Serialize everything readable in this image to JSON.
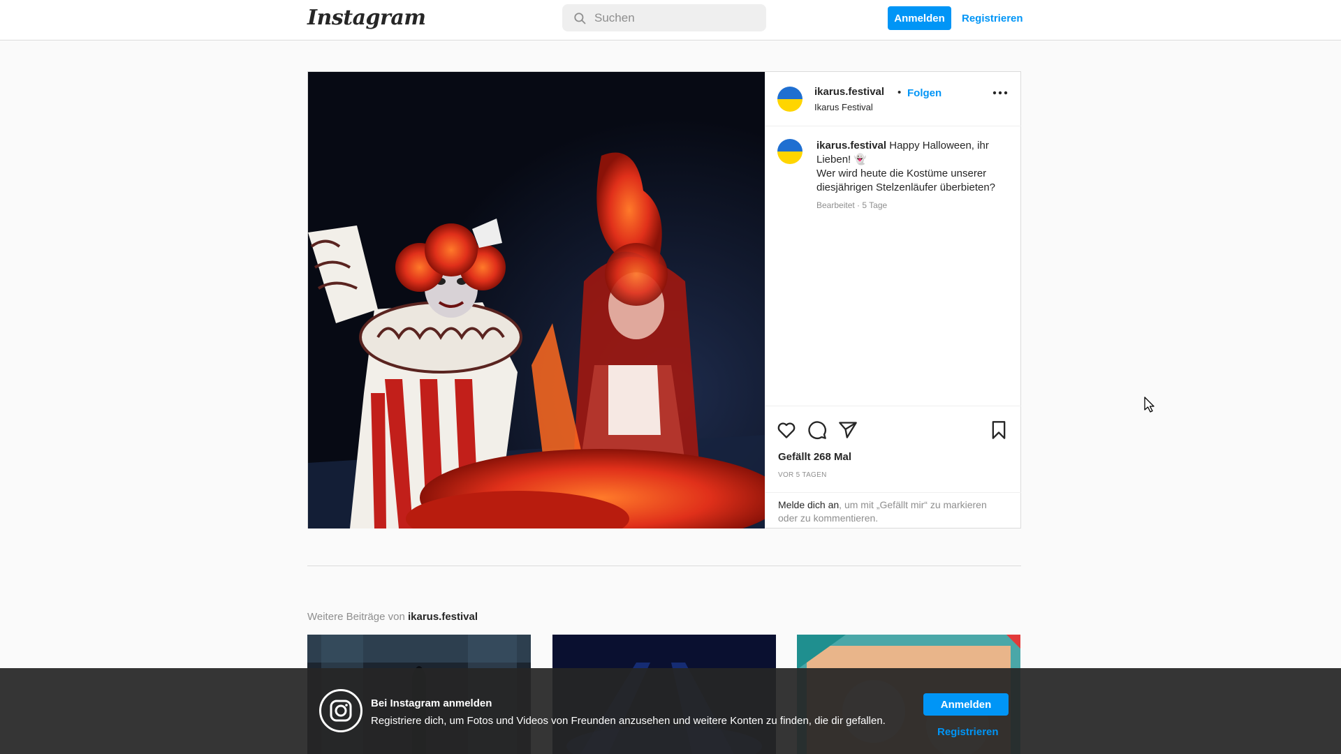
{
  "header": {
    "logo": "Instagram",
    "search_placeholder": "Suchen",
    "login_label": "Anmelden",
    "register_label": "Registrieren"
  },
  "post": {
    "username": "ikarus.festival",
    "separator": "•",
    "follow_label": "Folgen",
    "display_name": "Ikarus Festival",
    "caption_user": "ikarus.festival",
    "caption_text": "Happy Halloween, ihr Lieben! 👻",
    "caption_text_2": "Wer wird heute die Kostüme unserer diesjährigen Stelzenläufer überbieten?",
    "edited_meta": "Bearbeitet · 5 Tage",
    "likes": "Gefällt 268 Mal",
    "time": "VOR 5 TAGEN",
    "login_link": "Melde dich an",
    "login_hint": ", um mit „Gefällt mir“ zu markieren oder zu kommentieren.",
    "icons": [
      "like-icon",
      "comment-icon",
      "share-icon",
      "save-icon",
      "more-options-icon"
    ]
  },
  "more_posts": {
    "prefix": "Weitere Beiträge von ",
    "username": "ikarus.festival"
  },
  "banner": {
    "title": "Bei Instagram anmelden",
    "text": "Registriere dich, um Fotos und Videos von Freunden anzusehen und weitere Konten zu finden, die dir gefallen.",
    "login_label": "Anmelden",
    "register_label": "Registrieren"
  },
  "colors": {
    "accent": "#0095f6",
    "banner_bg": "#262626",
    "border": "#dbdbdb"
  }
}
